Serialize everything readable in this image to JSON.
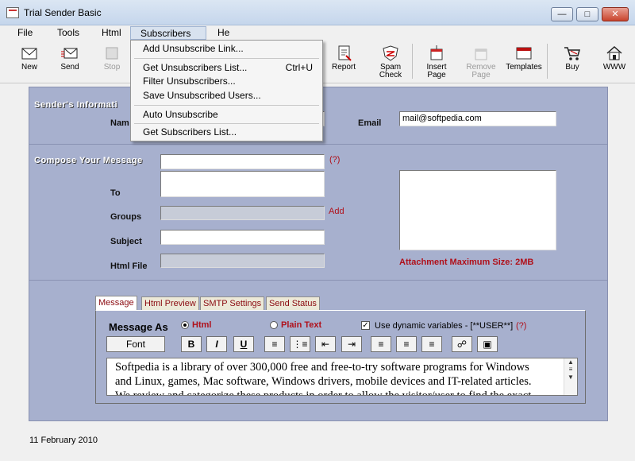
{
  "window": {
    "title": "Trial Sender Basic"
  },
  "menubar": [
    {
      "label": "File",
      "name": "menu-file"
    },
    {
      "label": "Tools",
      "name": "menu-tools"
    },
    {
      "label": "Html",
      "name": "menu-html"
    },
    {
      "label": "Subscribers",
      "name": "menu-subscribers"
    },
    {
      "label": "He",
      "name": "menu-help"
    }
  ],
  "toolbar": {
    "new": "New",
    "send": "Send",
    "stop": "Stop",
    "report": "Report",
    "spam_check": [
      "Spam",
      "Check"
    ],
    "insert_page": [
      "Insert",
      "Page"
    ],
    "remove_page": [
      "Remove",
      "Page"
    ],
    "templates": "Templates",
    "buy": "Buy",
    "www": "WWW"
  },
  "dropdown": {
    "items": [
      {
        "label": "Add Unsubscribe Link...",
        "shortcut": ""
      },
      {
        "label": "Get Unsubscribers List...",
        "shortcut": "Ctrl+U"
      },
      {
        "label": "Filter Unsubscribers...",
        "shortcut": ""
      },
      {
        "label": "Save Unsubscribed Users...",
        "shortcut": ""
      },
      {
        "label": "Auto Unsubscribe",
        "shortcut": ""
      },
      {
        "label": "Get Subscribers List...",
        "shortcut": ""
      }
    ]
  },
  "sender": {
    "section_title": "Sender's Informati",
    "name_label": "Nam",
    "email_label": "Email",
    "email_value": "mail@softpedia.com"
  },
  "compose": {
    "section_title": "Compose Your Message",
    "help": "(?)",
    "to_label": "To",
    "groups_label": "Groups",
    "add_link": "Add",
    "subject_label": "Subject",
    "html_file_label": "Html File",
    "attachment_note": "Attachment Maximum Size: 2MB"
  },
  "tabs": [
    "Message",
    "Html Preview",
    "SMTP Settings",
    "Send Status"
  ],
  "message": {
    "message_as_label": "Message As",
    "html_option": "Html",
    "plain_option": "Plain Text",
    "dynamic_label": "Use dynamic variables - [**USER**]",
    "dynamic_help": "(?)",
    "font_button": "Font",
    "bold": "B",
    "italic": "I",
    "underline": "U",
    "body_lines": [
      "Softpedia is a library of over 300,000 free and free-to-try software programs for Windows",
      "and Linux, games, Mac software, Windows drivers, mobile devices and IT-related articles.",
      "We review and categorize these products in order to allow the visitor/user to find the exact"
    ]
  },
  "footer": {
    "date": "11 February 2010"
  },
  "colors": {
    "panel": "#a7b0ce",
    "accent_red": "#b0101a"
  }
}
